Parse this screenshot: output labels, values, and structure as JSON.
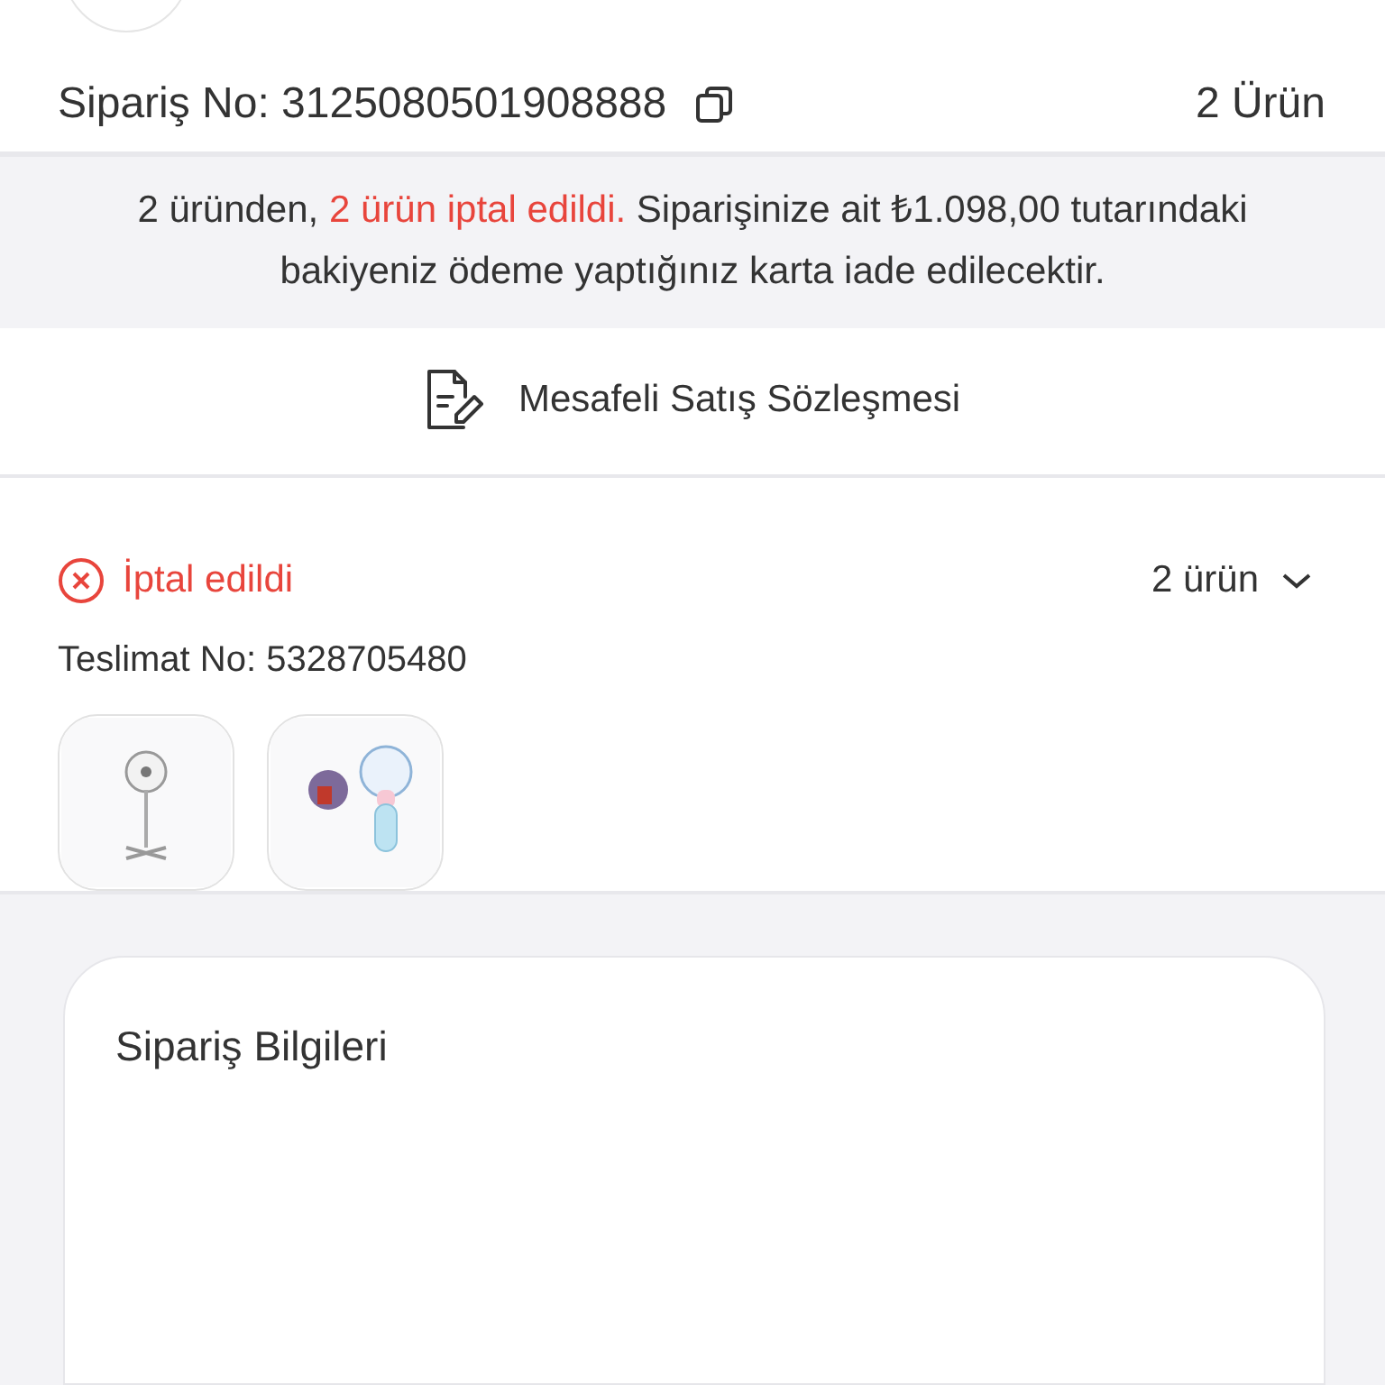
{
  "order": {
    "label": "Sipariş No:",
    "number": "3125080501908888",
    "item_count": "2 Ürün"
  },
  "notice": {
    "segments": [
      {
        "text": "2 üründen, ",
        "highlight": false
      },
      {
        "text": "2 ürün iptal edildi.",
        "highlight": true
      },
      {
        "text": " Siparişinize ait ₺1.098,00 tutarındaki bakiyeniz ödeme yaptığınız karta iade edilecektir.",
        "highlight": false
      }
    ]
  },
  "contract": {
    "label": "Mesafeli Satış Sözleşmesi"
  },
  "shipment": {
    "status": {
      "label": "İptal edildi",
      "kind": "cancelled"
    },
    "count": "2 ürün",
    "expanded": false,
    "delivery_label": "Teslimat No:",
    "delivery_number": "5328705480"
  },
  "info_card": {
    "title": "Sipariş Bilgileri"
  }
}
